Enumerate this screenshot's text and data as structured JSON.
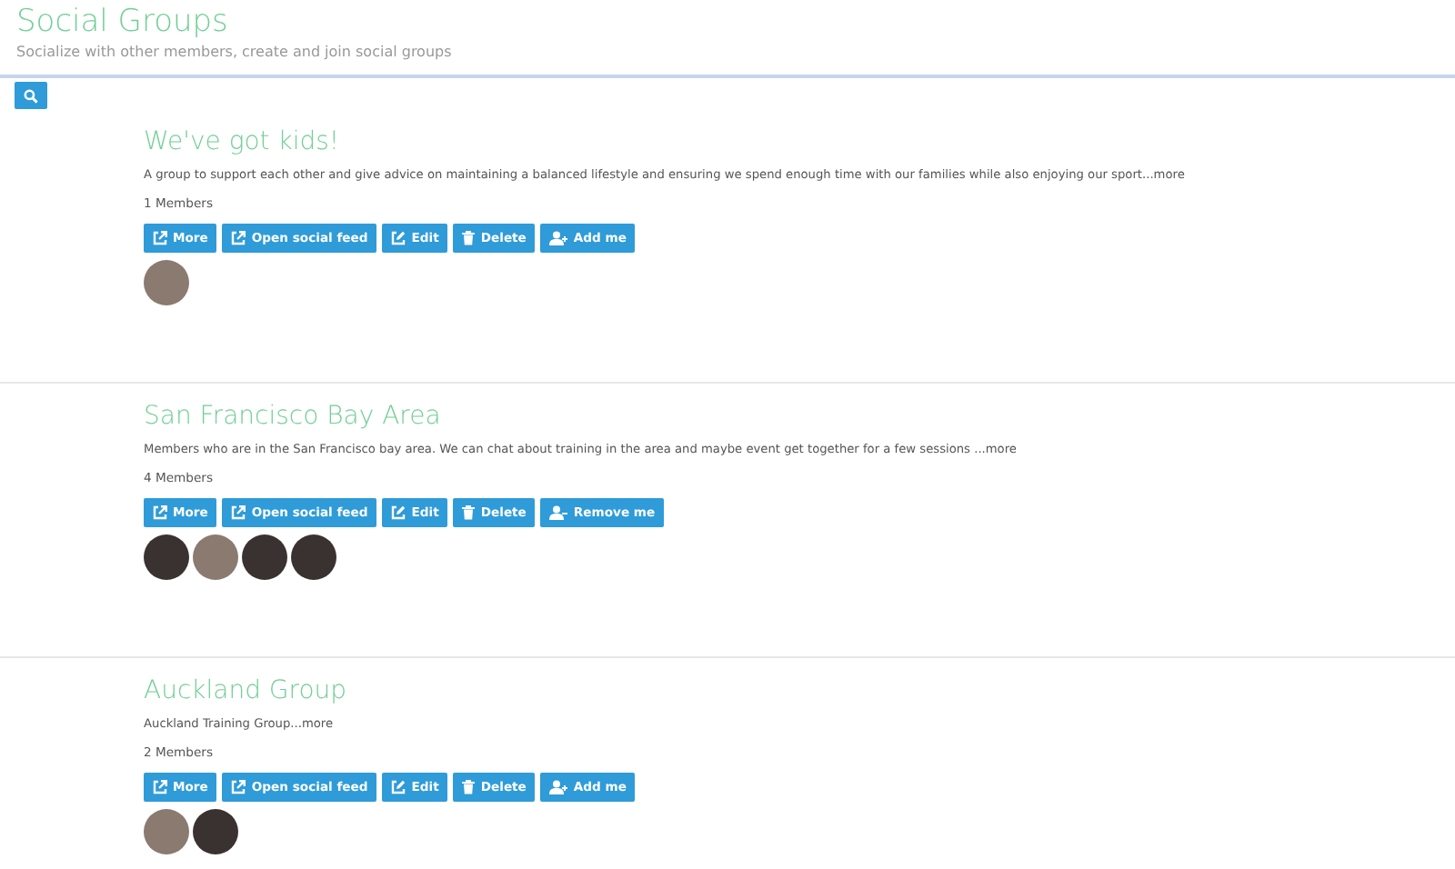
{
  "header": {
    "title": "Social Groups",
    "subtitle": "Socialize with other members, create and join social groups"
  },
  "groups": [
    {
      "name": "We've got kids!",
      "description": "A group to support each other and give advice on maintaining a balanced lifestyle and ensuring we spend enough time with our families while also enjoying our sport",
      "more_link": "...more",
      "members_count": "1 Members",
      "buttons": [
        {
          "kind": "external",
          "label": "More"
        },
        {
          "kind": "external",
          "label": "Open social feed"
        },
        {
          "kind": "edit",
          "label": "Edit"
        },
        {
          "kind": "delete",
          "label": "Delete"
        },
        {
          "kind": "add-user",
          "label": "Add me"
        }
      ],
      "avatars": [
        {
          "kind": "light"
        }
      ]
    },
    {
      "name": "San Francisco Bay Area",
      "description": "Members who are in the San Francisco bay area. We can chat about training in the area and maybe event get together for a few sessions ",
      "more_link": "...more",
      "members_count": "4 Members",
      "buttons": [
        {
          "kind": "external",
          "label": "More"
        },
        {
          "kind": "external",
          "label": "Open social feed"
        },
        {
          "kind": "edit",
          "label": "Edit"
        },
        {
          "kind": "delete",
          "label": "Delete"
        },
        {
          "kind": "remove-user",
          "label": "Remove me"
        }
      ],
      "avatars": [
        {
          "kind": "dark"
        },
        {
          "kind": "light"
        },
        {
          "kind": "dark"
        },
        {
          "kind": "dark"
        }
      ]
    },
    {
      "name": "Auckland Group",
      "description": "Auckland Training Group",
      "more_link": "...more",
      "members_count": "2 Members",
      "buttons": [
        {
          "kind": "external",
          "label": "More"
        },
        {
          "kind": "external",
          "label": "Open social feed"
        },
        {
          "kind": "edit",
          "label": "Edit"
        },
        {
          "kind": "delete",
          "label": "Delete"
        },
        {
          "kind": "add-user",
          "label": "Add me"
        }
      ],
      "avatars": [
        {
          "kind": "light"
        },
        {
          "kind": "dark"
        }
      ]
    }
  ]
}
